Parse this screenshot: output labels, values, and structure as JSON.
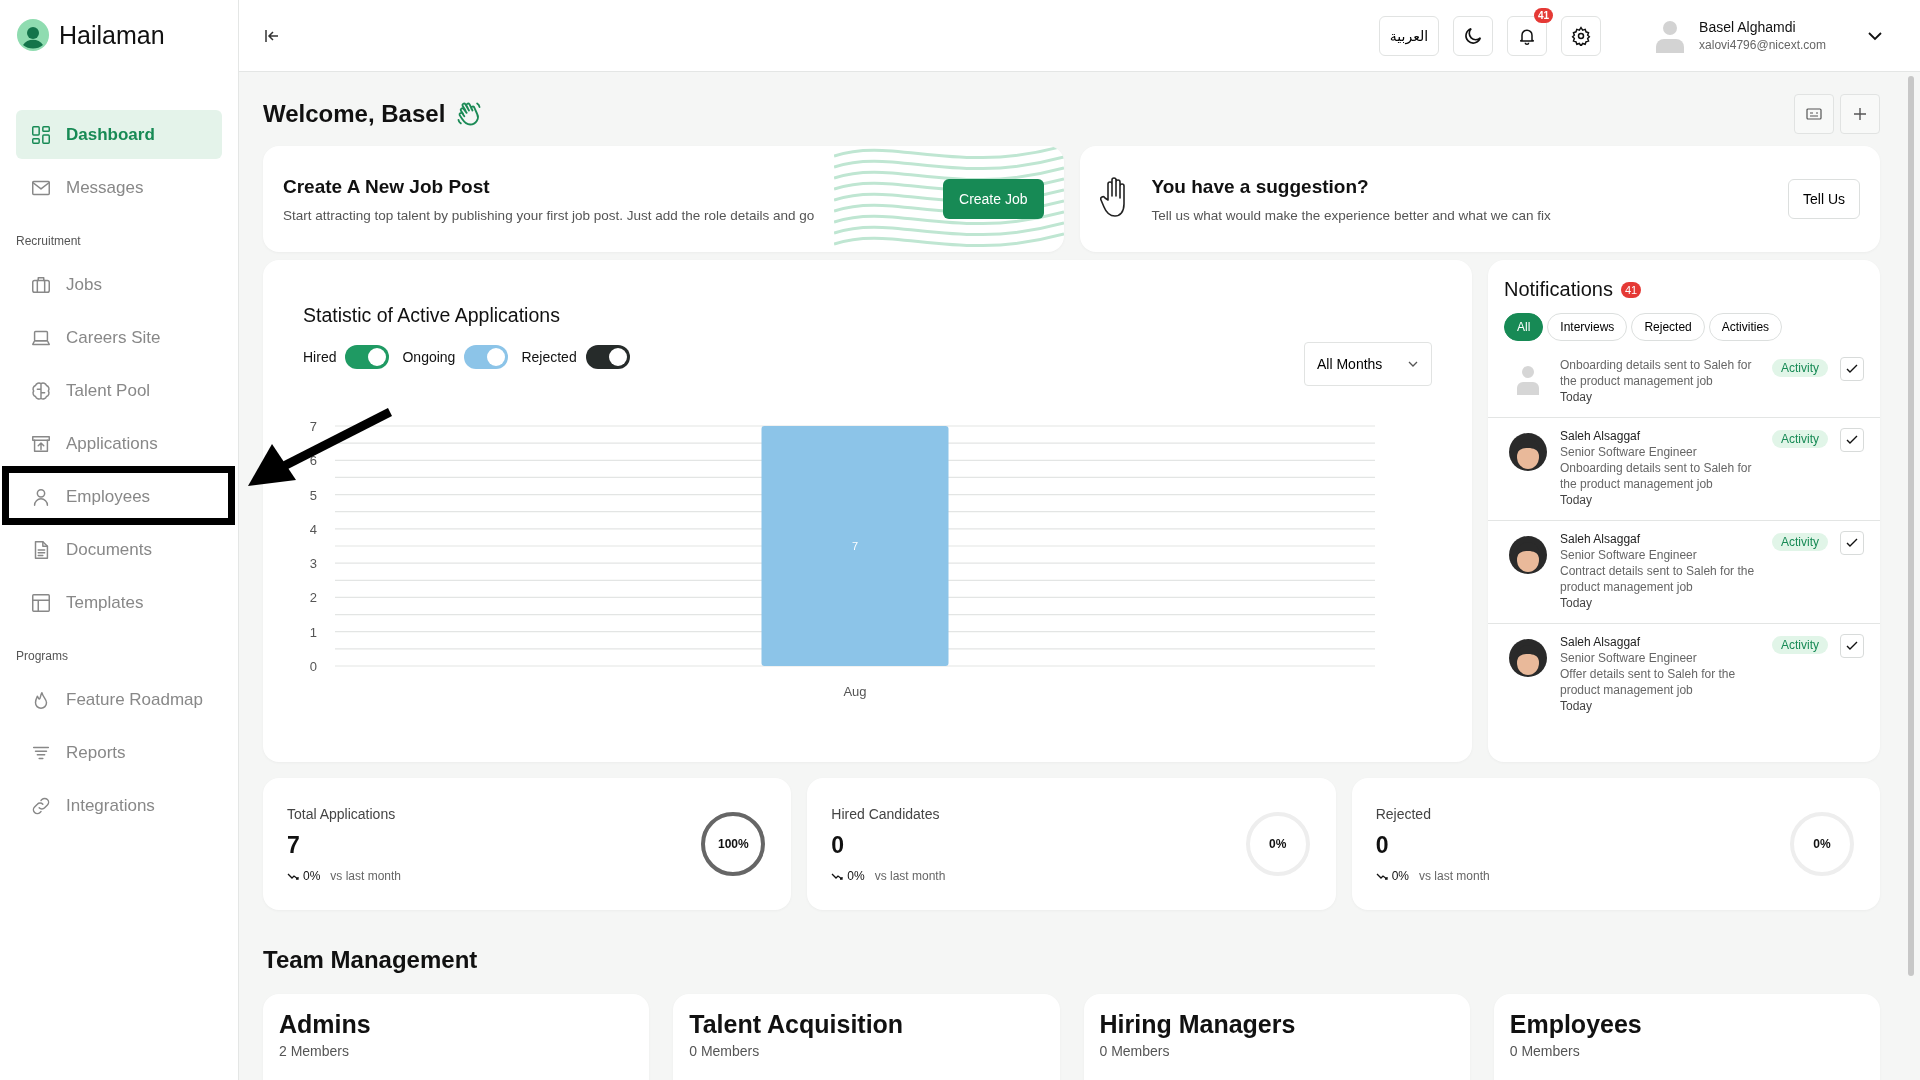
{
  "brand": {
    "name": "Hailaman"
  },
  "sidebar": {
    "groups": [
      {
        "items": [
          {
            "label": "Dashboard",
            "selected": true,
            "highlighted": false
          },
          {
            "label": "Messages",
            "selected": false,
            "highlighted": false
          }
        ]
      },
      {
        "heading": "Recruitment",
        "items": [
          {
            "label": "Jobs",
            "selected": false,
            "highlighted": false
          },
          {
            "label": "Careers Site",
            "selected": false,
            "highlighted": false
          },
          {
            "label": "Talent Pool",
            "selected": false,
            "highlighted": false
          },
          {
            "label": "Applications",
            "selected": false,
            "highlighted": false
          },
          {
            "label": "Employees",
            "selected": false,
            "highlighted": true
          },
          {
            "label": "Documents",
            "selected": false,
            "highlighted": false
          },
          {
            "label": "Templates",
            "selected": false,
            "highlighted": false
          }
        ]
      },
      {
        "heading": "Programs",
        "items": [
          {
            "label": "Feature Roadmap",
            "selected": false,
            "highlighted": false
          },
          {
            "label": "Reports",
            "selected": false,
            "highlighted": false
          },
          {
            "label": "Integrations",
            "selected": false,
            "highlighted": false
          }
        ]
      }
    ]
  },
  "header": {
    "language": "العربية",
    "notification_count": "41",
    "user": {
      "name": "Basel Alghamdi",
      "email": "xalovi4796@nicext.com"
    }
  },
  "welcome": "Welcome, Basel",
  "job_card": {
    "title": "Create A New Job Post",
    "text": "Start attracting top talent by publishing your first job post. Just add the role details and go",
    "button": "Create Job"
  },
  "suggestion_card": {
    "title": "You have a suggestion?",
    "text": "Tell us what would make the experience better and what we can fix",
    "button": "Tell Us"
  },
  "statistics": {
    "title": "Statistic of Active Applications",
    "toggles": [
      {
        "label": "Hired",
        "on": true,
        "color": "#1f9a63"
      },
      {
        "label": "Ongoing",
        "on": true,
        "color": "#8cc4e8"
      },
      {
        "label": "Rejected",
        "on": true,
        "color": "#262b2a"
      }
    ],
    "period": "All Months",
    "chart_data": {
      "type": "bar",
      "categories": [
        "Aug"
      ],
      "series": [
        {
          "color": "#8cc4e8",
          "values": [
            7
          ]
        }
      ],
      "ylim": [
        0,
        7
      ],
      "yticks": [
        0,
        1,
        2,
        3,
        4,
        5,
        6,
        7
      ],
      "data_labels": true,
      "grid": true
    }
  },
  "notifications": {
    "title": "Notifications",
    "count": "41",
    "filters": [
      {
        "label": "All",
        "selected": true
      },
      {
        "label": "Interviews",
        "selected": false
      },
      {
        "label": "Rejected",
        "selected": false
      },
      {
        "label": "Activities",
        "selected": false
      }
    ],
    "items": [
      {
        "kind": "placeholder",
        "message": "Onboarding details sent to Saleh for the product management job",
        "time": "Today",
        "tag": "Activity"
      },
      {
        "kind": "photo",
        "name": "Saleh Alsaggaf",
        "role": "Senior Software Engineer",
        "message": "Onboarding details sent to Saleh for the product management job",
        "time": "Today",
        "tag": "Activity"
      },
      {
        "kind": "photo",
        "name": "Saleh Alsaggaf",
        "role": "Senior Software Engineer",
        "message": "Contract details sent to Saleh for the product management job",
        "time": "Today",
        "tag": "Activity"
      },
      {
        "kind": "photo",
        "name": "Saleh Alsaggaf",
        "role": "Senior Software Engineer",
        "message": "Offer details sent to Saleh for the product management job",
        "time": "Today",
        "tag": "Activity"
      }
    ]
  },
  "stats": [
    {
      "label": "Total Applications",
      "value": "7",
      "change": "0%",
      "note": "vs last month",
      "ring": "100%",
      "level": 1
    },
    {
      "label": "Hired Candidates",
      "value": "0",
      "change": "0%",
      "note": "vs last month",
      "ring": "0%",
      "level": 0
    },
    {
      "label": "Rejected",
      "value": "0",
      "change": "0%",
      "note": "vs last month",
      "ring": "0%",
      "level": 0
    }
  ],
  "team_management": {
    "title": "Team Management",
    "teams": [
      {
        "name": "Admins",
        "members": "2 Members"
      },
      {
        "name": "Talent Acquisition",
        "members": "0 Members"
      },
      {
        "name": "Hiring Managers",
        "members": "0 Members"
      },
      {
        "name": "Employees",
        "members": "0 Members"
      }
    ]
  }
}
